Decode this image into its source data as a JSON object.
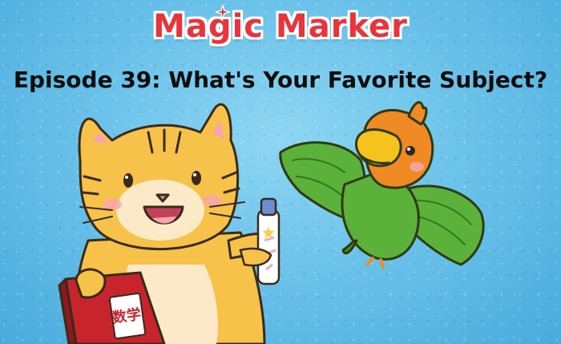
{
  "logo": {
    "text": "Magic Marker"
  },
  "episode": {
    "title": "Episode 39: What's Your Favorite Subject?"
  },
  "book": {
    "label": "数学"
  },
  "icons": {
    "cat": "cat-character",
    "parrot": "parrot-character",
    "marker": "magic-marker-pen",
    "book": "math-textbook",
    "sparkle": "sparkle-star"
  },
  "colors": {
    "background": "#6cc3ea",
    "logo_red": "#e8343c",
    "cat_orange": "#f7c24a",
    "parrot_green": "#5cb13a",
    "parrot_orange": "#f08a24",
    "book_red": "#c8242e"
  }
}
